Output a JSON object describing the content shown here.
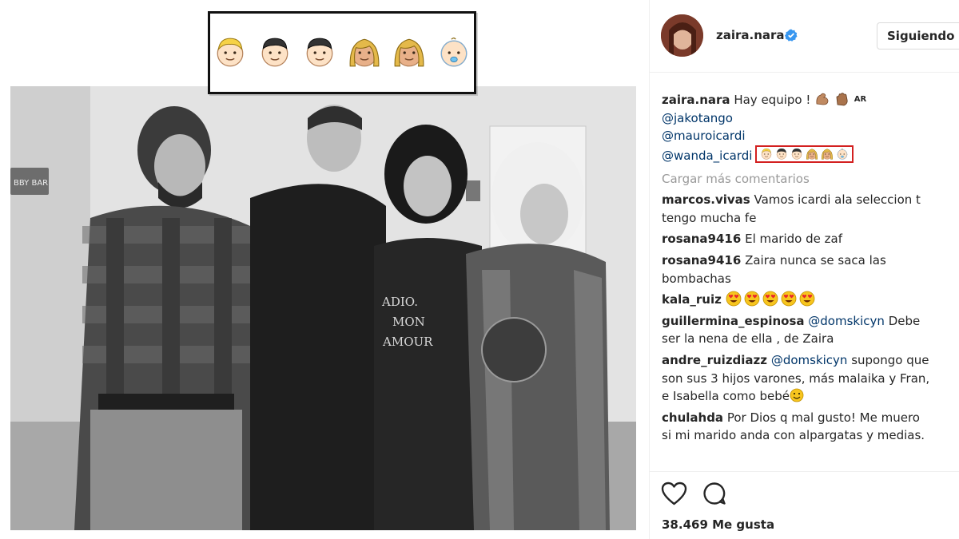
{
  "post": {
    "username": "zaira.nara",
    "follow_button": "Siguiendo",
    "caption": {
      "username": "zaira.nara",
      "text": "Hay equipo !",
      "flag_text": "AR",
      "mentions": [
        "@jakotango",
        "@mauroicardi",
        "@wanda_icardi"
      ]
    },
    "load_more": "Cargar más comentarios",
    "comments": [
      {
        "user": "marcos.vivas",
        "lines": [
          "Vamos icardi ala seleccion t",
          "tengo mucha fe"
        ]
      },
      {
        "user": "rosana9416",
        "lines": [
          "El marido de zaf"
        ]
      },
      {
        "user": "rosana9416",
        "lines": [
          "Zaira nunca se saca las",
          "bombachas"
        ]
      },
      {
        "user": "kala_ruiz",
        "lines": [
          ""
        ]
      },
      {
        "user": "guillermina_espinosa",
        "mention": "@domskicyn",
        "lines": [
          "Debe",
          "ser la nena de ella , de Zaira"
        ]
      },
      {
        "user": "andre_ruizdiazz",
        "mention": "@domskicyn",
        "lines": [
          "supongo que",
          "son sus 3 hijos varones, más malaika y Fran,",
          "e Isabella como bebé"
        ]
      },
      {
        "user": "chulahda",
        "lines": [
          "Por Dios q mal gusto! Me muero",
          "si mi marido anda con alpargatas y medias."
        ]
      }
    ],
    "likes": "38.469 Me gusta"
  },
  "photo": {
    "shirt_text": [
      "ADIO.",
      "MON",
      "AMOUR"
    ],
    "sign_text": "BBY BAR"
  },
  "emoji_set": [
    "blond-boy-face",
    "dark-hair-boy-face",
    "dark-hair-boy-face",
    "blonde-girl-face",
    "blonde-girl-face",
    "baby-face"
  ],
  "colors": {
    "mention": "#003569",
    "verified": "#3897f0",
    "highlight": "#d32020"
  }
}
